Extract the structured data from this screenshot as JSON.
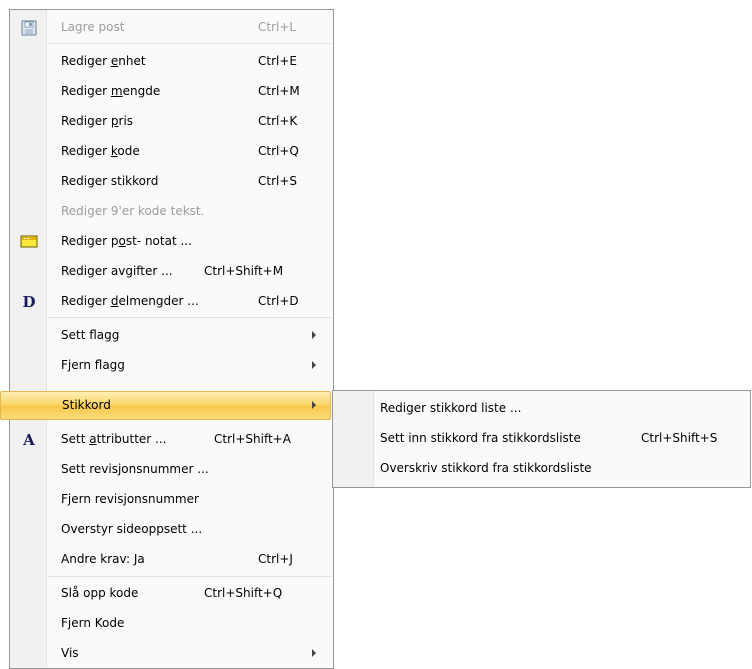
{
  "menu": {
    "items": [
      {
        "pre": "Lagre post",
        "u": "",
        "post": "",
        "shortcut": "Ctrl+L"
      },
      {
        "pre": "Rediger ",
        "u": "e",
        "post": "nhet",
        "shortcut": "Ctrl+E"
      },
      {
        "pre": "Rediger ",
        "u": "m",
        "post": "engde",
        "shortcut": "Ctrl+M"
      },
      {
        "pre": "Rediger ",
        "u": "p",
        "post": "ris",
        "shortcut": "Ctrl+K"
      },
      {
        "pre": "Rediger ",
        "u": "k",
        "post": "ode",
        "shortcut": "Ctrl+Q"
      },
      {
        "pre": "Rediger stikkord",
        "u": "",
        "post": "",
        "shortcut": "Ctrl+S"
      },
      {
        "pre": "Rediger 9'er kode tekst.",
        "u": "",
        "post": "",
        "shortcut": ""
      },
      {
        "pre": "Rediger p",
        "u": "o",
        "post": "st- notat ...",
        "shortcut": ""
      },
      {
        "pre": "Rediger avgifter ...",
        "u": "",
        "post": "",
        "shortcut": "Ctrl+Shift+M"
      },
      {
        "pre": "Rediger ",
        "u": "d",
        "post": "elmengder ...",
        "shortcut": "Ctrl+D"
      },
      {
        "pre": "Sett flagg",
        "u": "",
        "post": "",
        "shortcut": ""
      },
      {
        "pre": "Fjern flagg",
        "u": "",
        "post": "",
        "shortcut": ""
      },
      {
        "pre": "Stikkord",
        "u": "",
        "post": "",
        "shortcut": ""
      },
      {
        "pre": "Sett ",
        "u": "a",
        "post": "ttributter ...",
        "shortcut": "Ctrl+Shift+A"
      },
      {
        "pre": "Sett revisjonsnummer ...",
        "u": "",
        "post": "",
        "shortcut": ""
      },
      {
        "pre": "Fjern revisjonsnummer",
        "u": "",
        "post": "",
        "shortcut": ""
      },
      {
        "pre": "Overstyr sideoppsett ...",
        "u": "",
        "post": "",
        "shortcut": ""
      },
      {
        "pre": "Andre krav: Ja",
        "u": "",
        "post": "",
        "shortcut": "Ctrl+J"
      },
      {
        "pre": "Slå opp kode",
        "u": "",
        "post": "",
        "shortcut": "Ctrl+Shift+Q"
      },
      {
        "pre": "Fjern Kode",
        "u": "",
        "post": "",
        "shortcut": ""
      },
      {
        "pre": "Vis",
        "u": "",
        "post": "",
        "shortcut": ""
      }
    ],
    "icons": {
      "D": "D",
      "A": "A"
    }
  },
  "submenu": {
    "items": [
      {
        "label": "Rediger stikkord liste ...",
        "shortcut": ""
      },
      {
        "label": "Sett inn stikkord fra stikkordsliste",
        "shortcut": "Ctrl+Shift+S"
      },
      {
        "label": "Overskriv stikkord fra stikkordsliste",
        "shortcut": ""
      }
    ]
  },
  "colors": {
    "highlight": "#fbd562",
    "disabled_text": "#9d9d9d"
  }
}
